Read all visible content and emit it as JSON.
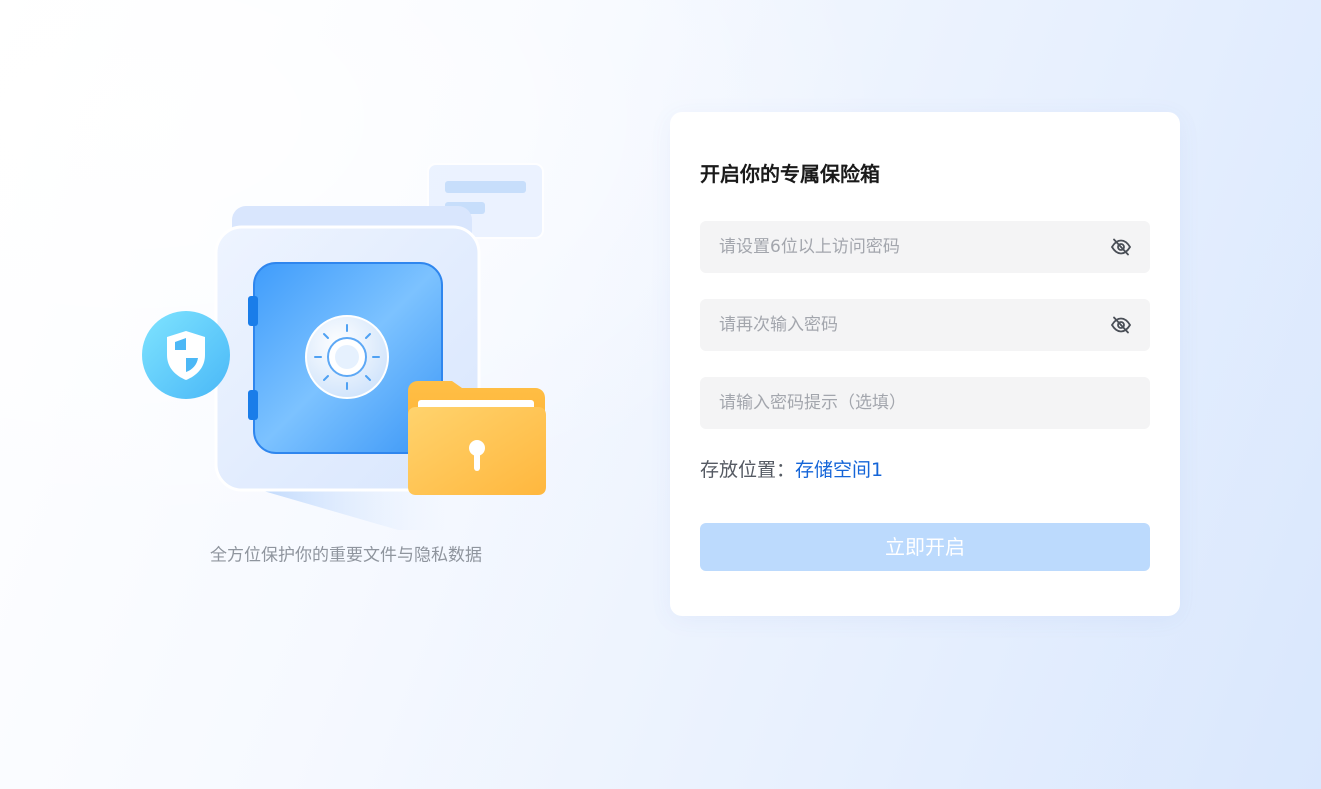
{
  "illustration": {
    "caption": "全方位保护你的重要文件与隐私数据",
    "icons": [
      "safe-icon",
      "shield-icon",
      "folder-lock-icon",
      "note-card-icon"
    ]
  },
  "form": {
    "title": "开启你的专属保险箱",
    "password": {
      "placeholder": "请设置6位以上访问密码",
      "value": "",
      "toggle_icon": "eye-hidden-icon"
    },
    "confirm": {
      "placeholder": "请再次输入密码",
      "value": "",
      "toggle_icon": "eye-hidden-icon"
    },
    "hint": {
      "placeholder": "请输入密码提示（选填）",
      "value": ""
    },
    "location_label": "存放位置：",
    "location_value": "存储空间1",
    "submit_label": "立即开启"
  },
  "colors": {
    "accent": "#1565d8",
    "button_disabled": "#bcdafd",
    "input_bg": "#f4f4f5",
    "placeholder": "#a3a6ad"
  }
}
